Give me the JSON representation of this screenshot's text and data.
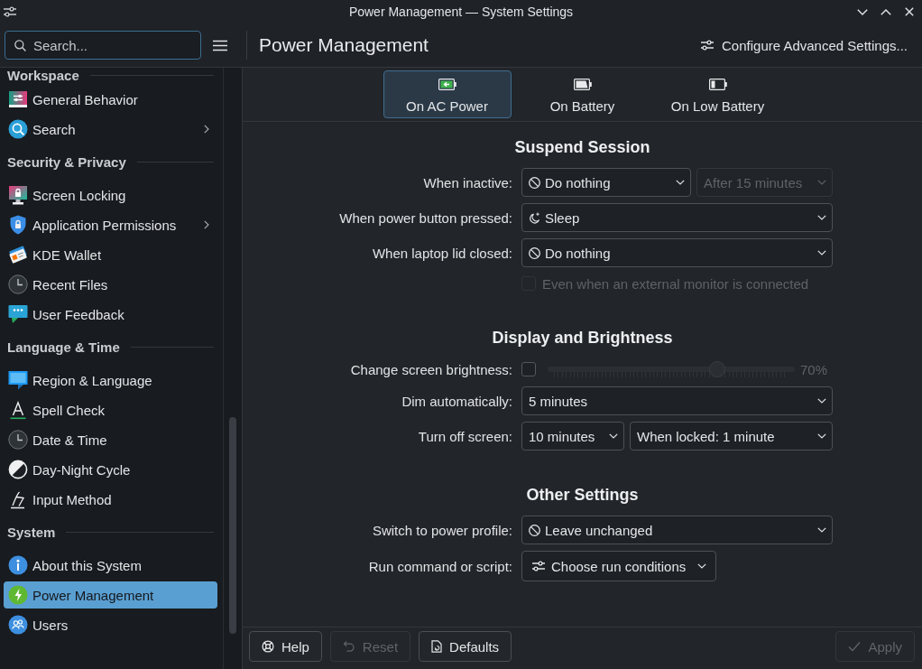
{
  "window": {
    "title": "Power Management — System Settings"
  },
  "sidebar": {
    "search": {
      "placeholder": "Search..."
    },
    "groups": [
      {
        "title": "Workspace",
        "items": [
          {
            "label": "General Behavior",
            "has_children": false,
            "selected": false
          },
          {
            "label": "Search",
            "has_children": true,
            "selected": false
          }
        ]
      },
      {
        "title": "Security & Privacy",
        "items": [
          {
            "label": "Screen Locking",
            "has_children": false,
            "selected": false
          },
          {
            "label": "Application Permissions",
            "has_children": true,
            "selected": false
          },
          {
            "label": "KDE Wallet",
            "has_children": false,
            "selected": false
          },
          {
            "label": "Recent Files",
            "has_children": false,
            "selected": false
          },
          {
            "label": "User Feedback",
            "has_children": false,
            "selected": false
          }
        ]
      },
      {
        "title": "Language & Time",
        "items": [
          {
            "label": "Region & Language",
            "has_children": false,
            "selected": false
          },
          {
            "label": "Spell Check",
            "has_children": false,
            "selected": false
          },
          {
            "label": "Date & Time",
            "has_children": false,
            "selected": false
          },
          {
            "label": "Day-Night Cycle",
            "has_children": false,
            "selected": false
          },
          {
            "label": "Input Method",
            "has_children": false,
            "selected": false
          }
        ]
      },
      {
        "title": "System",
        "items": [
          {
            "label": "About this System",
            "has_children": false,
            "selected": false
          },
          {
            "label": "Power Management",
            "has_children": false,
            "selected": true
          },
          {
            "label": "Users",
            "has_children": false,
            "selected": false
          }
        ]
      }
    ]
  },
  "header": {
    "title": "Power Management",
    "action_button": "Configure Advanced Settings..."
  },
  "tabs": [
    {
      "label": "On AC Power",
      "selected": true
    },
    {
      "label": "On Battery",
      "selected": false
    },
    {
      "label": "On Low Battery",
      "selected": false
    }
  ],
  "sections": [
    {
      "title": "Suspend Session",
      "rows": [
        {
          "label": "When inactive:",
          "controls": [
            {
              "kind": "dropdown",
              "value": "Do nothing",
              "disabled": false
            },
            {
              "kind": "dropdown",
              "value": "After 15 minutes",
              "disabled": true
            }
          ]
        },
        {
          "label": "When power button pressed:",
          "controls": [
            {
              "kind": "dropdown",
              "value": "Sleep",
              "disabled": false
            }
          ]
        },
        {
          "label": "When laptop lid closed:",
          "controls": [
            {
              "kind": "dropdown",
              "value": "Do nothing",
              "disabled": false
            }
          ]
        },
        {
          "controls": [
            {
              "kind": "checkbox",
              "label": "Even when an external monitor is connected",
              "checked": false,
              "disabled": true
            }
          ]
        }
      ]
    },
    {
      "title": "Display and Brightness",
      "rows": [
        {
          "label": "Change screen brightness:",
          "controls": [
            {
              "kind": "checkbox",
              "checked": false,
              "disabled": false
            },
            {
              "kind": "slider",
              "level": 0.7,
              "disabled": true,
              "reading": "70%"
            }
          ]
        },
        {
          "label": "Dim automatically:",
          "controls": [
            {
              "kind": "dropdown",
              "value": "5 minutes",
              "disabled": false
            }
          ]
        },
        {
          "label": "Turn off screen:",
          "controls": [
            {
              "kind": "dropdown",
              "value": "10 minutes",
              "disabled": false
            },
            {
              "kind": "dropdown",
              "value": "When locked: 1 minute",
              "disabled": false
            }
          ]
        }
      ]
    },
    {
      "title": "Other Settings",
      "rows": [
        {
          "label": "Switch to power profile:",
          "controls": [
            {
              "kind": "dropdown",
              "value": "Leave unchanged",
              "disabled": false
            }
          ]
        },
        {
          "label": "Run command or script:",
          "controls": [
            {
              "kind": "menu-button",
              "value": "Choose run conditions",
              "disabled": false
            }
          ]
        }
      ]
    }
  ],
  "footer": {
    "buttons": [
      {
        "label": "Help",
        "disabled": false
      },
      {
        "label": "Reset",
        "disabled": true
      },
      {
        "label": "Defaults",
        "disabled": false
      },
      {
        "label": "Apply",
        "disabled": true
      }
    ]
  }
}
